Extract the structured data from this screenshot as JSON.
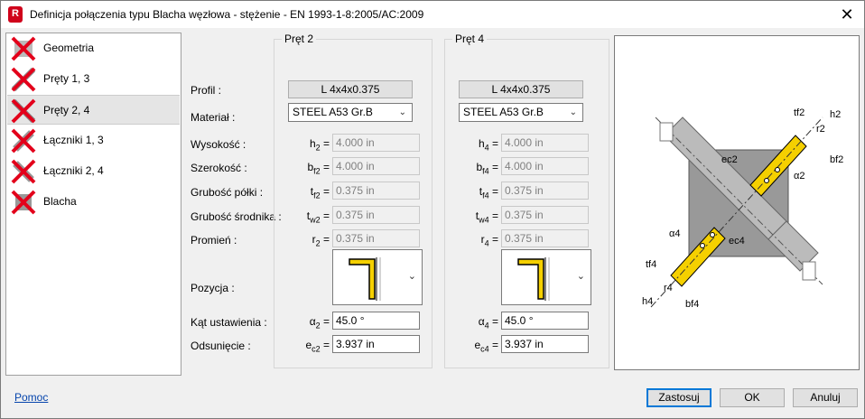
{
  "window": {
    "title": "Definicja połączenia typu Blacha węzłowa - stężenie  - EN 1993-1-8:2005/AC:2009",
    "app_icon_letter": "R"
  },
  "tree": {
    "items": [
      {
        "label": "Geometria",
        "selected": false
      },
      {
        "label": "Pręty 1, 3",
        "selected": false
      },
      {
        "label": "Pręty 2, 4",
        "selected": true
      },
      {
        "label": "Łączniki 1, 3",
        "selected": false
      },
      {
        "label": "Łączniki 2, 4",
        "selected": false
      },
      {
        "label": "Blacha",
        "selected": false
      }
    ]
  },
  "labels": {
    "profil": "Profil :",
    "material": "Materiał :",
    "wysokosc": "Wysokość :",
    "szerokosc": "Szerokość :",
    "grubosc_polki": "Grubość półki :",
    "grubosc_srodnika": "Grubość środnika :",
    "promien": "Promień :",
    "pozycja": "Pozycja :",
    "kat": "Kąt ustawienia :",
    "odsuniecie": "Odsunięcie :"
  },
  "bar2": {
    "title": "Pręt 2",
    "profile": "L 4x4x0.375",
    "material": "STEEL A53 Gr.B",
    "h": "4.000 in",
    "b": "4.000 in",
    "t": "0.375 in",
    "tw": "0.375 in",
    "r": "0.375 in",
    "alpha": "45.0 °",
    "e": "3.937 in",
    "sym": {
      "h": "h",
      "h_sub": "2",
      "b": "b",
      "b_sub": "f2",
      "t": "t",
      "t_sub": "f2",
      "tw": "t",
      "tw_sub": "w2",
      "r": "r",
      "r_sub": "2",
      "alpha": "α",
      "alpha_sub": "2",
      "e": "e",
      "e_sub": "c2"
    }
  },
  "bar4": {
    "title": "Pręt 4",
    "profile": "L 4x4x0.375",
    "material": "STEEL A53 Gr.B",
    "h": "4.000 in",
    "b": "4.000 in",
    "t": "0.375 in",
    "tw": "0.375 in",
    "r": "0.375 in",
    "alpha": "45.0 °",
    "e": "3.937 in",
    "sym": {
      "h": "h",
      "h_sub": "4",
      "b": "b",
      "b_sub": "f4",
      "t": "t",
      "t_sub": "f4",
      "tw": "t",
      "tw_sub": "w4",
      "r": "r",
      "r_sub": "4",
      "alpha": "α",
      "alpha_sub": "4",
      "e": "e",
      "e_sub": "c4"
    }
  },
  "eq": "=",
  "drawing": {
    "labels": [
      "tf2",
      "h2",
      "r2",
      "bf2",
      "ec2",
      "α2",
      "α4",
      "ec4",
      "tf4",
      "r4",
      "h4",
      "bf4"
    ]
  },
  "footer": {
    "help": "Pomoc",
    "apply": "Zastosuj",
    "ok": "OK",
    "cancel": "Anuluj"
  },
  "colors": {
    "accent": "#0078d7",
    "angle_yellow": "#f5d000",
    "error_red": "#e3001b"
  }
}
